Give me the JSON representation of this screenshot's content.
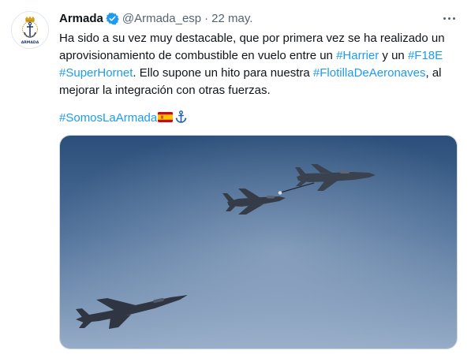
{
  "tweet": {
    "author_name": "Armada",
    "handle": "@Armada_esp",
    "separator": "·",
    "date": "22 may.",
    "avatar_label": "ARMADA",
    "verified_icon": "verified-badge-icon",
    "more_icon": "more-options-icon",
    "text_lines": [
      [
        "Ha sido a su vez muy destacable, que por primera vez se ha realizado un"
      ],
      [
        "aprovisionamiento de combustible en vuelo entre un ",
        "#Harrier",
        " y un ",
        "#F18E"
      ],
      [
        "#SuperHornet",
        ". Ello supone un hito para nuestra ",
        "#FlotillaDeAeronaves",
        ", al"
      ],
      [
        "mejorar la integración con otras fuerzas."
      ]
    ],
    "hashtag_line": "#SomosLaArmada",
    "emojis": [
      "spain-flag-icon",
      "anchor-icon"
    ],
    "media_alt": "aerial-refueling-photo"
  },
  "colors": {
    "link": "#1d9bf0",
    "text": "#0f1419",
    "secondary": "#536471",
    "sky_top": "#2e527c",
    "sky_bottom": "#93aac6"
  }
}
